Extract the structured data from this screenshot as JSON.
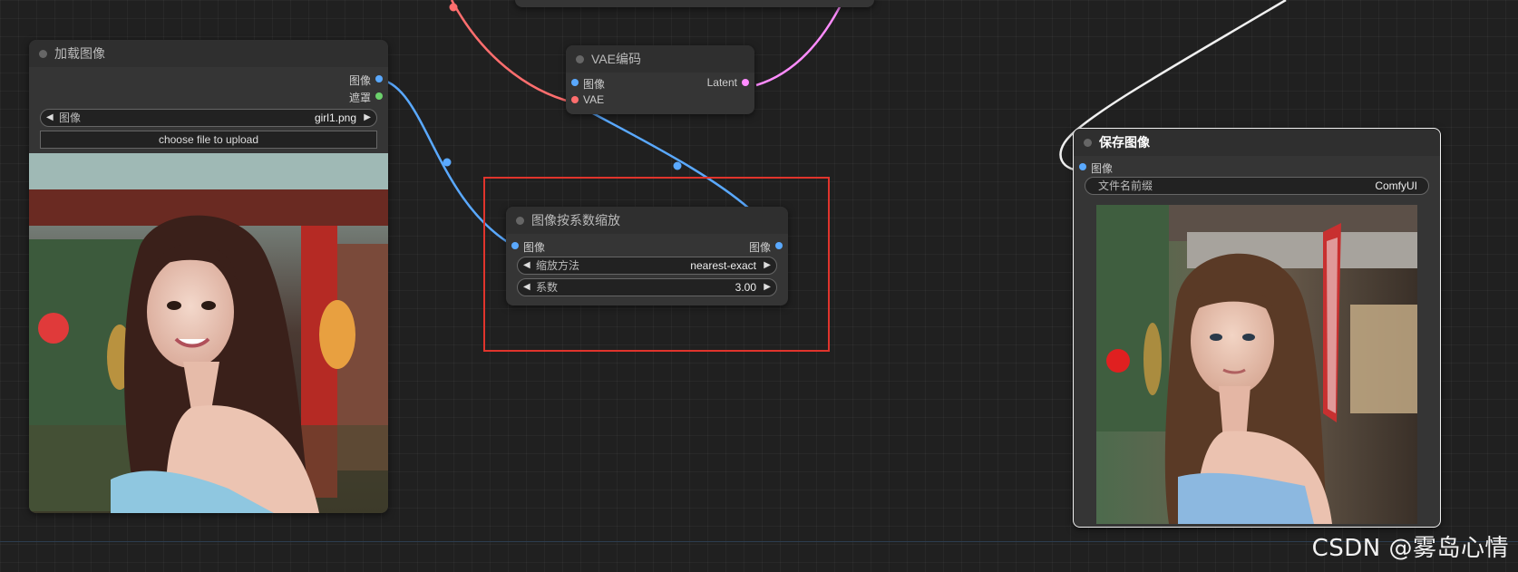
{
  "colors": {
    "image_slot": "#5aa9ff",
    "mask_slot": "#6cd16c",
    "vae_slot": "#ff6e6e",
    "latent_slot": "#ff8cff",
    "selection": "#e0342c",
    "canvas": "#202020"
  },
  "load_image_node": {
    "title": "加载图像",
    "outputs": [
      "图像",
      "遮罩"
    ],
    "image_widget": {
      "label": "图像",
      "value": "girl1.png"
    },
    "upload_button": "choose file to upload"
  },
  "vae_encode_node": {
    "title": "VAE编码",
    "inputs": [
      "图像",
      "VAE"
    ],
    "outputs": [
      "Latent"
    ]
  },
  "scale_node": {
    "title": "图像按系数缩放",
    "input": "图像",
    "output": "图像",
    "method_widget": {
      "label": "缩放方法",
      "value": "nearest-exact"
    },
    "factor_widget": {
      "label": "系数",
      "value": "3.00"
    }
  },
  "save_image_node": {
    "title": "保存图像",
    "input": "图像",
    "prefix_widget": {
      "label": "文件名前缀",
      "value": "ComfyUI"
    }
  },
  "watermark": "CSDN @雾岛心情"
}
